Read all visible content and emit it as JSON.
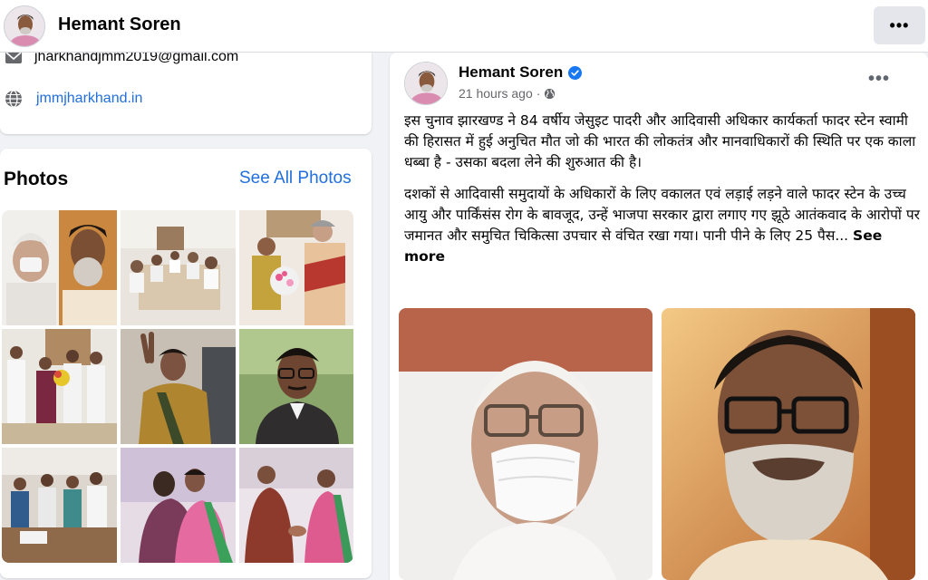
{
  "header": {
    "profile_name": "Hemant Soren",
    "more_label": "•••"
  },
  "intro": {
    "email": "jharkhandjmm2019@gmail.com",
    "website": "jmmjharkhand.in"
  },
  "photos": {
    "title": "Photos",
    "see_all": "See All Photos"
  },
  "post": {
    "author": "Hemant Soren",
    "time": "21 hours ago",
    "separator": "·",
    "more_label": "•••",
    "paragraph1": "इस चुनाव झारखण्ड ने 84 वर्षीय जेसुइट पादरी और आदिवासी अधिकार कार्यकर्ता फादर स्टेन स्वामी की हिरासत में हुई अनुचित मौत जो की भारत की लोकतंत्र और मानवाधिकारों की स्थिति पर एक काला धब्बा है - उसका बदला लेने की शुरुआत की है।",
    "paragraph2": "दशकों से आदिवासी समुदायों के अधिकारों के लिए वकालत एवं लड़ाई लड़ने वाले फादर स्टेन के उच्च आयु और पार्किंसंस रोग के बावजूद, उन्हें भाजपा सरकार द्वारा लगाए गए झूठे आतंकवाद के आरोपों पर जमानत और समुचित चिकित्सा उपचार से वंचित रखा गया। पानी पीने के लिए 25 पैस...",
    "see_more": "See more"
  },
  "colors": {
    "link": "#216fdb",
    "verified": "#1877f2",
    "meta": "#65676b"
  }
}
